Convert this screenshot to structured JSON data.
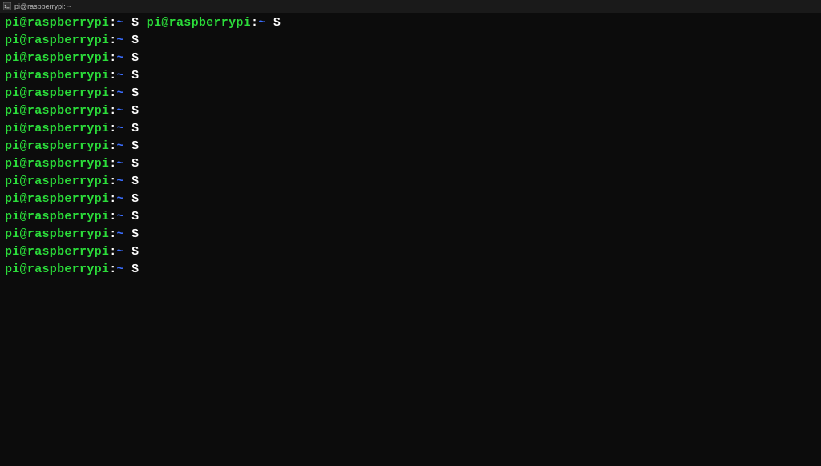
{
  "titlebar": {
    "icon_label": "terminal-icon",
    "title": "pi@raspberrypi: ~"
  },
  "prompt": {
    "user_host": "pi@raspberrypi",
    "colon": ":",
    "path": "~",
    "symbol": "$"
  },
  "first_line_has_double_prompt": true,
  "line_count": 15
}
